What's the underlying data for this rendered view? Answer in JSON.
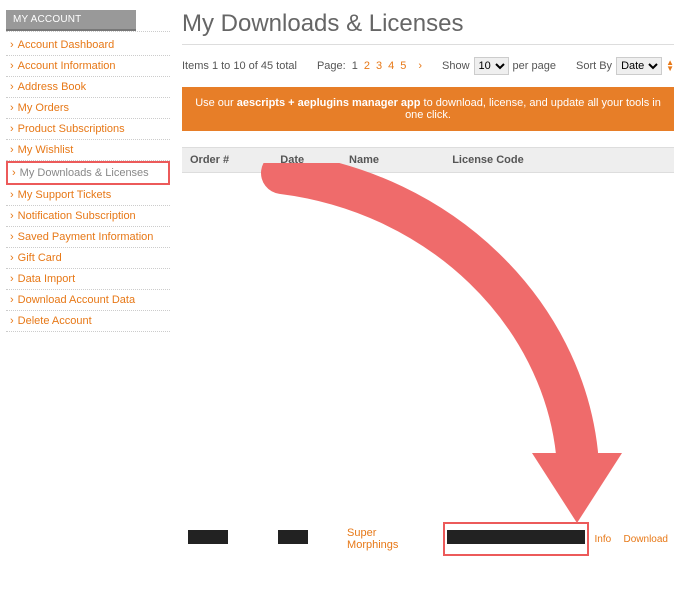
{
  "sidebar": {
    "header": "MY ACCOUNT",
    "items": [
      {
        "label": "Account Dashboard",
        "highlight": false
      },
      {
        "label": "Account Information",
        "highlight": false
      },
      {
        "label": "Address Book",
        "highlight": false
      },
      {
        "label": "My Orders",
        "highlight": false
      },
      {
        "label": "Product Subscriptions",
        "highlight": false
      },
      {
        "label": "My Wishlist",
        "highlight": false
      },
      {
        "label": "My Downloads & Licenses",
        "highlight": true
      },
      {
        "label": "My Support Tickets",
        "highlight": false
      },
      {
        "label": "Notification Subscription",
        "highlight": false
      },
      {
        "label": "Saved Payment Information",
        "highlight": false
      },
      {
        "label": "Gift Card",
        "highlight": false
      },
      {
        "label": "Data Import",
        "highlight": false
      },
      {
        "label": "Download Account Data",
        "highlight": false
      },
      {
        "label": "Delete Account",
        "highlight": false
      }
    ]
  },
  "title": "My Downloads & Licenses",
  "toolbar": {
    "summary": "Items 1 to 10 of 45 total",
    "page_label": "Page:",
    "pages": [
      "1",
      "2",
      "3",
      "4",
      "5"
    ],
    "next_glyph": "›",
    "show_label": "Show",
    "per_page_value": "10",
    "per_page_suffix": "per page",
    "sort_label": "Sort By",
    "sort_value": "Date"
  },
  "banner": {
    "prefix": "Use our ",
    "bold": "aescripts + aeplugins manager app",
    "suffix": " to download, license, and update all your tools in one click."
  },
  "table": {
    "headers": {
      "order": "Order #",
      "date": "Date",
      "name": "Name",
      "license": "License Code"
    },
    "row": {
      "name": "Super Morphings",
      "info_label": "Info",
      "download_label": "Download"
    }
  }
}
